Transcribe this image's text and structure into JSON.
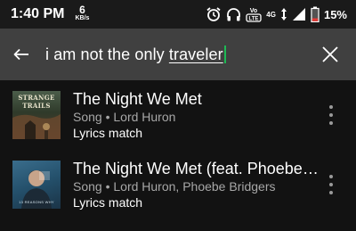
{
  "status_bar": {
    "time": "1:40 PM",
    "net_speed_value": "6",
    "net_speed_unit": "KB/s",
    "volte_label": "Vo LTE",
    "network_label": "4G",
    "battery_percent": "15%",
    "icons": [
      "alarm-icon",
      "headphones-icon",
      "volte-icon",
      "data-arrows-icon",
      "signal-icon",
      "battery-icon"
    ]
  },
  "search": {
    "query_prefix": "i am not the only ",
    "query_underlined": "traveler",
    "caret_color": "#1db954"
  },
  "results": [
    {
      "title": "The Night We Met",
      "subtitle": "Song • Lord Huron",
      "match": "Lyrics match",
      "art_text": "STRANGE TRAILS"
    },
    {
      "title": "The Night We Met (feat. Phoebe Bridgers)",
      "subtitle": "Song • Lord Huron, Phoebe Bridgers",
      "match": "Lyrics match",
      "art_text": "13 REASONS WHY"
    }
  ],
  "colors": {
    "background": "#121212",
    "search_bar": "#404040",
    "secondary_text": "#a7a7a7",
    "accent": "#1db954"
  }
}
